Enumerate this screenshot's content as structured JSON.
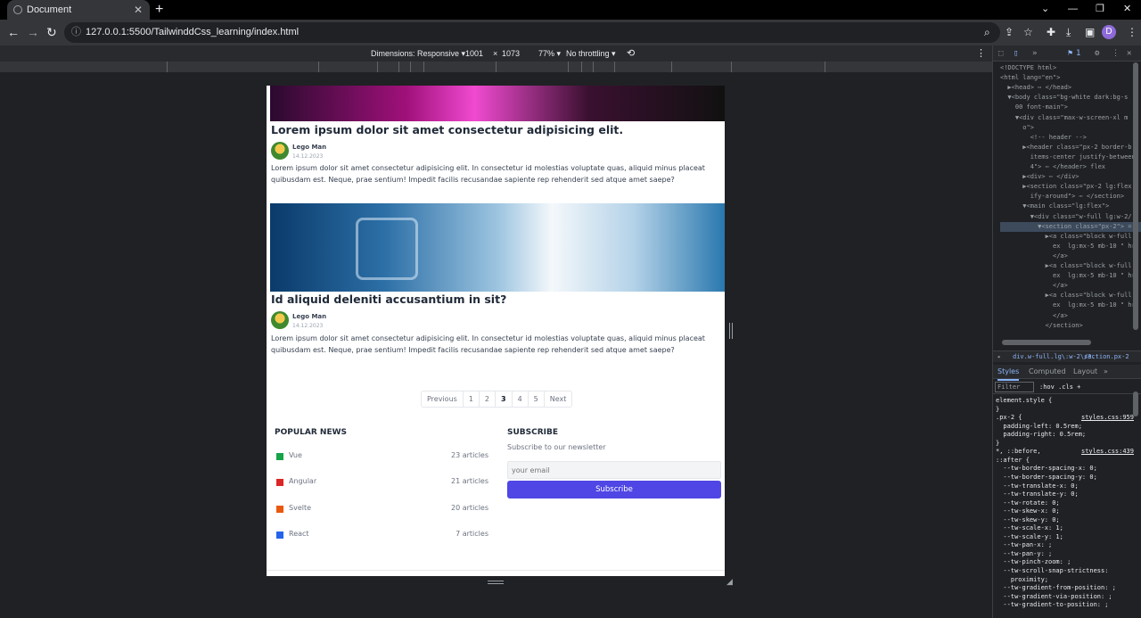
{
  "browser": {
    "tab_title": "Document",
    "new_tab": "+",
    "url": "127.0.0.1:5500/TailwinddCss_learning/index.html",
    "avatar_letter": "D"
  },
  "device_toolbar": {
    "dimensions_label": "Dimensions: Responsive ▾",
    "width": "1001",
    "times": "×",
    "height": "1073",
    "zoom": "77% ▾",
    "throttling": "No throttling ▾"
  },
  "page": {
    "posts": [
      {
        "title": "Lorem ipsum dolor sit amet consectetur adipisicing elit.",
        "author": "Lego Man",
        "date": "14.12.2023",
        "excerpt": "Lorem ipsum dolor sit amet consectetur adipisicing elit. In consectetur id molestias voluptate quas, aliquid minus placeat quibusdam est. Neque, prae sentium! Impedit facilis recusandae sapiente rep rehenderit sed atque amet saepe?"
      },
      {
        "title": "Id aliquid deleniti accusantium in sit?",
        "author": "Lego Man",
        "date": "14.12.2023",
        "excerpt": "Lorem ipsum dolor sit amet consectetur adipisicing elit. In consectetur id molestias voluptate quas, aliquid minus placeat quibusdam est. Neque, prae sentium! Impedit facilis recusandae sapiente rep rehenderit sed atque amet saepe?"
      }
    ],
    "pagination": {
      "previous": "Previous",
      "pages": [
        "1",
        "2",
        "3",
        "4",
        "5"
      ],
      "current": "3",
      "next": "Next"
    },
    "popular_news": {
      "title": "POPULAR NEWS",
      "items": [
        {
          "name": "Vue",
          "count": "23 articles",
          "color": "#16a34a"
        },
        {
          "name": "Angular",
          "count": "21 articles",
          "color": "#dc2626"
        },
        {
          "name": "Svelte",
          "count": "20 articles",
          "color": "#ea580c"
        },
        {
          "name": "React",
          "count": "7 articles",
          "color": "#2563eb"
        }
      ]
    },
    "subscribe": {
      "title": "SUBSCRIBE",
      "text": "Subscribe to our newsletter",
      "placeholder": "your email",
      "button": "Subscribe",
      "button_color": "#4f46e5"
    }
  },
  "devtools": {
    "issues_count": "1",
    "dom": [
      "<!DOCTYPE html>",
      "<html lang=\"en\">",
      "  ▶<head> ⋯ </head>",
      "  ▼<body class=\"bg-white dark:bg-s",
      "    00 font-main\">",
      "    ▼<div class=\"max-w-screen-xl m",
      "      o\">",
      "        <!-- header -->",
      "      ▶<header class=\"px-2 border-b",
      "        items-center justify-between",
      "        4\"> ⋯ </header> flex",
      "      ▶<div> ⋯ </div>",
      "      ▶<section class=\"px-2 lg:flex",
      "        ify-around\"> ⋯ </section>",
      "      ▼<main class=\"lg:flex\">",
      "        ▼<div class=\"w-full lg:w-2/",
      "          ▼<section class=\"px-2\"> =",
      "            ▶<a class=\"block w-full",
      "              ex  lg:mx-5 mb-10 \" hr",
      "              </a>",
      "            ▶<a class=\"block w-full",
      "              ex  lg:mx-5 mb-10 \" hr",
      "              </a>",
      "            ▶<a class=\"block w-full",
      "              ex  lg:mx-5 mb-10 \" hr",
      "              </a>",
      "            </section>"
    ],
    "breadcrumbs": [
      "div.w-full.lg\\:w-2\\/3.",
      "section.px-2"
    ],
    "tabs": [
      "Styles",
      "Computed",
      "Layout",
      "»"
    ],
    "filter_placeholder": "Filter",
    "filter_tools": ":hov  .cls  +",
    "css": [
      {
        "text": "element.style {",
        "src": ""
      },
      {
        "text": "}",
        "src": ""
      },
      {
        "text": ".px-2 {",
        "src": "styles.css:959"
      },
      {
        "text": "  padding-left: 0.5rem;",
        "src": ""
      },
      {
        "text": "  padding-right: 0.5rem;",
        "src": ""
      },
      {
        "text": "}",
        "src": ""
      },
      {
        "text": "*, ::before,",
        "src": "styles.css:439"
      },
      {
        "text": "::after {",
        "src": ""
      },
      {
        "text": "  --tw-border-spacing-x: 0;",
        "src": ""
      },
      {
        "text": "  --tw-border-spacing-y: 0;",
        "src": ""
      },
      {
        "text": "  --tw-translate-x: 0;",
        "src": ""
      },
      {
        "text": "  --tw-translate-y: 0;",
        "src": ""
      },
      {
        "text": "  --tw-rotate: 0;",
        "src": ""
      },
      {
        "text": "  --tw-skew-x: 0;",
        "src": ""
      },
      {
        "text": "  --tw-skew-y: 0;",
        "src": ""
      },
      {
        "text": "  --tw-scale-x: 1;",
        "src": ""
      },
      {
        "text": "  --tw-scale-y: 1;",
        "src": ""
      },
      {
        "text": "  --tw-pan-x: ;",
        "src": ""
      },
      {
        "text": "  --tw-pan-y: ;",
        "src": ""
      },
      {
        "text": "  --tw-pinch-zoom: ;",
        "src": ""
      },
      {
        "text": "  --tw-scroll-snap-strictness:",
        "src": ""
      },
      {
        "text": "    proximity;",
        "src": ""
      },
      {
        "text": "  --tw-gradient-from-position: ;",
        "src": ""
      },
      {
        "text": "  --tw-gradient-via-position: ;",
        "src": ""
      },
      {
        "text": "  --tw-gradient-to-position: ;",
        "src": ""
      }
    ]
  }
}
